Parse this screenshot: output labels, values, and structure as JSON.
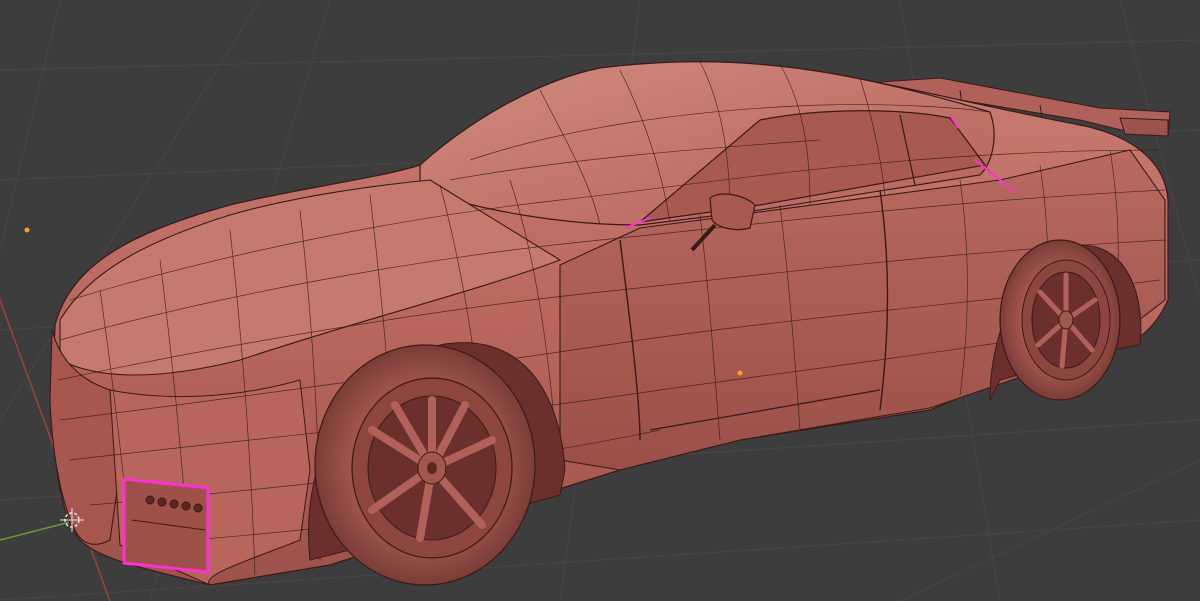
{
  "viewport": {
    "mode": "edit",
    "shading": "solid",
    "colors": {
      "background": "#3d3d3d",
      "grid": "#4a4a4a",
      "mesh_fill": "#b9675e",
      "mesh_light": "#cf8a7f",
      "mesh_dark": "#7a3a34",
      "wire": "#2b1210",
      "selected": "#ff2fd6",
      "x_axis": "#a0413d",
      "y_axis": "#6a9a2a",
      "origin": "#ff9a2a"
    },
    "icons": {
      "cursor": "3d-cursor-icon",
      "origin": "object-origin-icon"
    },
    "selection": {
      "headlight_border": "selected",
      "edge_highlights": 3
    }
  }
}
